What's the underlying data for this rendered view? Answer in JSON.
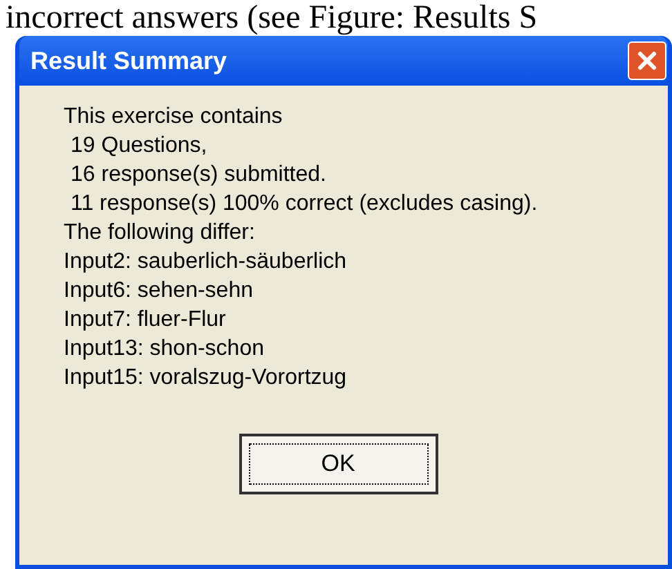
{
  "background_text": "incorrect answers (see Figure: Results S",
  "dialog": {
    "title": "Result Summary",
    "lines": [
      {
        "text": "This exercise contains",
        "indented": false
      },
      {
        "text": "19 Questions,",
        "indented": true
      },
      {
        "text": "16 response(s) submitted.",
        "indented": true
      },
      {
        "text": "11 response(s) 100% correct (excludes casing).",
        "indented": true
      },
      {
        "text": "The following differ:",
        "indented": false
      },
      {
        "text": "Input2: sauberlich-säuberlich",
        "indented": false
      },
      {
        "text": "Input6: sehen-sehn",
        "indented": false
      },
      {
        "text": "Input7: fluer-Flur",
        "indented": false
      },
      {
        "text": "Input13: shon-schon",
        "indented": false
      },
      {
        "text": "Input15: voralszug-Vorortzug",
        "indented": false
      }
    ],
    "buttons": [
      "OK"
    ]
  }
}
